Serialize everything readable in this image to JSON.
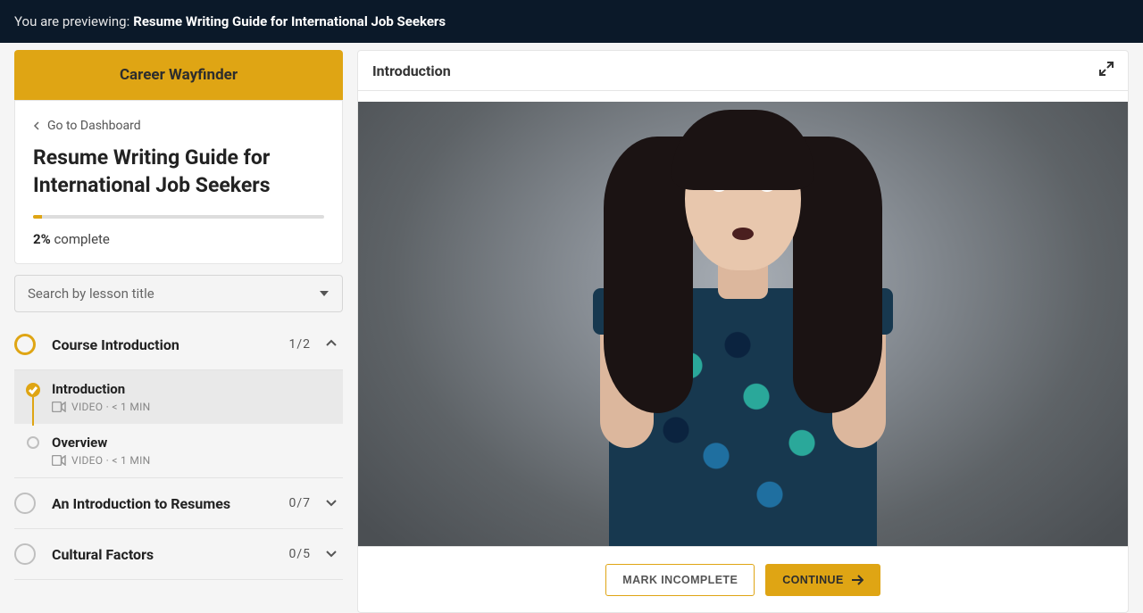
{
  "topbar": {
    "preview_label": "You are previewing:",
    "preview_title": "Resume Writing Guide for International Job Seekers"
  },
  "sidebar": {
    "brand": "Career Wayfinder",
    "dashboard_link": "Go to Dashboard",
    "course_title": "Resume Writing Guide for International Job Seekers",
    "progress_percent": "2%",
    "complete_word": "complete",
    "progress_fill_width": "3%",
    "search_placeholder": "Search by lesson title"
  },
  "sections": [
    {
      "label": "Course Introduction",
      "count": "1/2",
      "expanded": true,
      "ring": "gold",
      "lessons": [
        {
          "title": "Introduction",
          "meta": "VIDEO · < 1 MIN",
          "status": "complete",
          "active": true
        },
        {
          "title": "Overview",
          "meta": "VIDEO · < 1 MIN",
          "status": "incomplete",
          "active": false
        }
      ]
    },
    {
      "label": "An Introduction to Resumes",
      "count": "0/7",
      "expanded": false,
      "ring": "grey"
    },
    {
      "label": "Cultural Factors",
      "count": "0/5",
      "expanded": false,
      "ring": "grey"
    }
  ],
  "content": {
    "title": "Introduction"
  },
  "actions": {
    "mark_incomplete": "MARK INCOMPLETE",
    "continue": "CONTINUE"
  }
}
